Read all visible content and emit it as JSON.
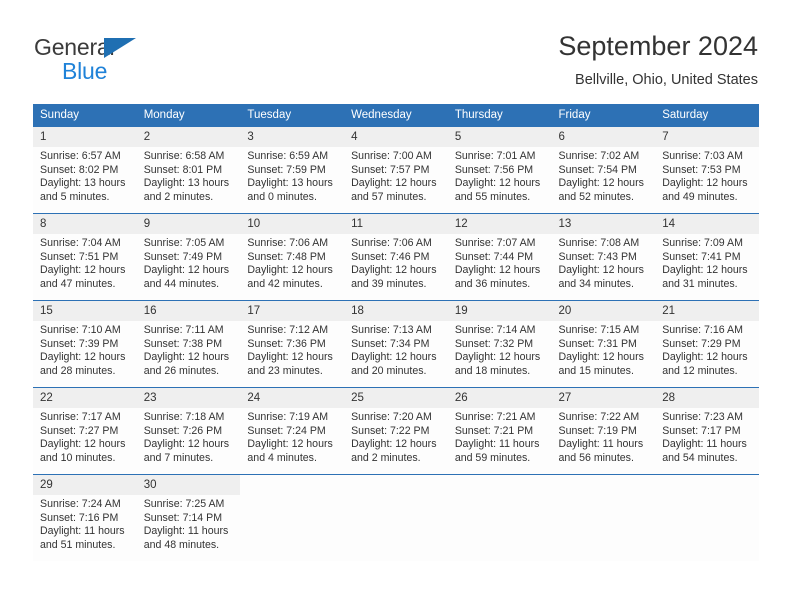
{
  "brand": {
    "name_part1": "General",
    "name_part2": "Blue",
    "triangle_color": "#1f6fb2"
  },
  "header": {
    "title": "September 2024",
    "subtitle": "Bellville, Ohio, United States",
    "accent_color": "#2d71b5",
    "daynum_band_color": "#efefef"
  },
  "calendar": {
    "weekday_headers": [
      "Sunday",
      "Monday",
      "Tuesday",
      "Wednesday",
      "Thursday",
      "Friday",
      "Saturday"
    ],
    "weeks": [
      [
        {
          "day": "1",
          "sunrise": "Sunrise: 6:57 AM",
          "sunset": "Sunset: 8:02 PM",
          "daylight_line1": "Daylight: 13 hours",
          "daylight_line2": "and 5 minutes."
        },
        {
          "day": "2",
          "sunrise": "Sunrise: 6:58 AM",
          "sunset": "Sunset: 8:01 PM",
          "daylight_line1": "Daylight: 13 hours",
          "daylight_line2": "and 2 minutes."
        },
        {
          "day": "3",
          "sunrise": "Sunrise: 6:59 AM",
          "sunset": "Sunset: 7:59 PM",
          "daylight_line1": "Daylight: 13 hours",
          "daylight_line2": "and 0 minutes."
        },
        {
          "day": "4",
          "sunrise": "Sunrise: 7:00 AM",
          "sunset": "Sunset: 7:57 PM",
          "daylight_line1": "Daylight: 12 hours",
          "daylight_line2": "and 57 minutes."
        },
        {
          "day": "5",
          "sunrise": "Sunrise: 7:01 AM",
          "sunset": "Sunset: 7:56 PM",
          "daylight_line1": "Daylight: 12 hours",
          "daylight_line2": "and 55 minutes."
        },
        {
          "day": "6",
          "sunrise": "Sunrise: 7:02 AM",
          "sunset": "Sunset: 7:54 PM",
          "daylight_line1": "Daylight: 12 hours",
          "daylight_line2": "and 52 minutes."
        },
        {
          "day": "7",
          "sunrise": "Sunrise: 7:03 AM",
          "sunset": "Sunset: 7:53 PM",
          "daylight_line1": "Daylight: 12 hours",
          "daylight_line2": "and 49 minutes."
        }
      ],
      [
        {
          "day": "8",
          "sunrise": "Sunrise: 7:04 AM",
          "sunset": "Sunset: 7:51 PM",
          "daylight_line1": "Daylight: 12 hours",
          "daylight_line2": "and 47 minutes."
        },
        {
          "day": "9",
          "sunrise": "Sunrise: 7:05 AM",
          "sunset": "Sunset: 7:49 PM",
          "daylight_line1": "Daylight: 12 hours",
          "daylight_line2": "and 44 minutes."
        },
        {
          "day": "10",
          "sunrise": "Sunrise: 7:06 AM",
          "sunset": "Sunset: 7:48 PM",
          "daylight_line1": "Daylight: 12 hours",
          "daylight_line2": "and 42 minutes."
        },
        {
          "day": "11",
          "sunrise": "Sunrise: 7:06 AM",
          "sunset": "Sunset: 7:46 PM",
          "daylight_line1": "Daylight: 12 hours",
          "daylight_line2": "and 39 minutes."
        },
        {
          "day": "12",
          "sunrise": "Sunrise: 7:07 AM",
          "sunset": "Sunset: 7:44 PM",
          "daylight_line1": "Daylight: 12 hours",
          "daylight_line2": "and 36 minutes."
        },
        {
          "day": "13",
          "sunrise": "Sunrise: 7:08 AM",
          "sunset": "Sunset: 7:43 PM",
          "daylight_line1": "Daylight: 12 hours",
          "daylight_line2": "and 34 minutes."
        },
        {
          "day": "14",
          "sunrise": "Sunrise: 7:09 AM",
          "sunset": "Sunset: 7:41 PM",
          "daylight_line1": "Daylight: 12 hours",
          "daylight_line2": "and 31 minutes."
        }
      ],
      [
        {
          "day": "15",
          "sunrise": "Sunrise: 7:10 AM",
          "sunset": "Sunset: 7:39 PM",
          "daylight_line1": "Daylight: 12 hours",
          "daylight_line2": "and 28 minutes."
        },
        {
          "day": "16",
          "sunrise": "Sunrise: 7:11 AM",
          "sunset": "Sunset: 7:38 PM",
          "daylight_line1": "Daylight: 12 hours",
          "daylight_line2": "and 26 minutes."
        },
        {
          "day": "17",
          "sunrise": "Sunrise: 7:12 AM",
          "sunset": "Sunset: 7:36 PM",
          "daylight_line1": "Daylight: 12 hours",
          "daylight_line2": "and 23 minutes."
        },
        {
          "day": "18",
          "sunrise": "Sunrise: 7:13 AM",
          "sunset": "Sunset: 7:34 PM",
          "daylight_line1": "Daylight: 12 hours",
          "daylight_line2": "and 20 minutes."
        },
        {
          "day": "19",
          "sunrise": "Sunrise: 7:14 AM",
          "sunset": "Sunset: 7:32 PM",
          "daylight_line1": "Daylight: 12 hours",
          "daylight_line2": "and 18 minutes."
        },
        {
          "day": "20",
          "sunrise": "Sunrise: 7:15 AM",
          "sunset": "Sunset: 7:31 PM",
          "daylight_line1": "Daylight: 12 hours",
          "daylight_line2": "and 15 minutes."
        },
        {
          "day": "21",
          "sunrise": "Sunrise: 7:16 AM",
          "sunset": "Sunset: 7:29 PM",
          "daylight_line1": "Daylight: 12 hours",
          "daylight_line2": "and 12 minutes."
        }
      ],
      [
        {
          "day": "22",
          "sunrise": "Sunrise: 7:17 AM",
          "sunset": "Sunset: 7:27 PM",
          "daylight_line1": "Daylight: 12 hours",
          "daylight_line2": "and 10 minutes."
        },
        {
          "day": "23",
          "sunrise": "Sunrise: 7:18 AM",
          "sunset": "Sunset: 7:26 PM",
          "daylight_line1": "Daylight: 12 hours",
          "daylight_line2": "and 7 minutes."
        },
        {
          "day": "24",
          "sunrise": "Sunrise: 7:19 AM",
          "sunset": "Sunset: 7:24 PM",
          "daylight_line1": "Daylight: 12 hours",
          "daylight_line2": "and 4 minutes."
        },
        {
          "day": "25",
          "sunrise": "Sunrise: 7:20 AM",
          "sunset": "Sunset: 7:22 PM",
          "daylight_line1": "Daylight: 12 hours",
          "daylight_line2": "and 2 minutes."
        },
        {
          "day": "26",
          "sunrise": "Sunrise: 7:21 AM",
          "sunset": "Sunset: 7:21 PM",
          "daylight_line1": "Daylight: 11 hours",
          "daylight_line2": "and 59 minutes."
        },
        {
          "day": "27",
          "sunrise": "Sunrise: 7:22 AM",
          "sunset": "Sunset: 7:19 PM",
          "daylight_line1": "Daylight: 11 hours",
          "daylight_line2": "and 56 minutes."
        },
        {
          "day": "28",
          "sunrise": "Sunrise: 7:23 AM",
          "sunset": "Sunset: 7:17 PM",
          "daylight_line1": "Daylight: 11 hours",
          "daylight_line2": "and 54 minutes."
        }
      ],
      [
        {
          "day": "29",
          "sunrise": "Sunrise: 7:24 AM",
          "sunset": "Sunset: 7:16 PM",
          "daylight_line1": "Daylight: 11 hours",
          "daylight_line2": "and 51 minutes."
        },
        {
          "day": "30",
          "sunrise": "Sunrise: 7:25 AM",
          "sunset": "Sunset: 7:14 PM",
          "daylight_line1": "Daylight: 11 hours",
          "daylight_line2": "and 48 minutes."
        },
        {
          "day": "",
          "sunrise": "",
          "sunset": "",
          "daylight_line1": "",
          "daylight_line2": ""
        },
        {
          "day": "",
          "sunrise": "",
          "sunset": "",
          "daylight_line1": "",
          "daylight_line2": ""
        },
        {
          "day": "",
          "sunrise": "",
          "sunset": "",
          "daylight_line1": "",
          "daylight_line2": ""
        },
        {
          "day": "",
          "sunrise": "",
          "sunset": "",
          "daylight_line1": "",
          "daylight_line2": ""
        },
        {
          "day": "",
          "sunrise": "",
          "sunset": "",
          "daylight_line1": "",
          "daylight_line2": ""
        }
      ]
    ]
  }
}
